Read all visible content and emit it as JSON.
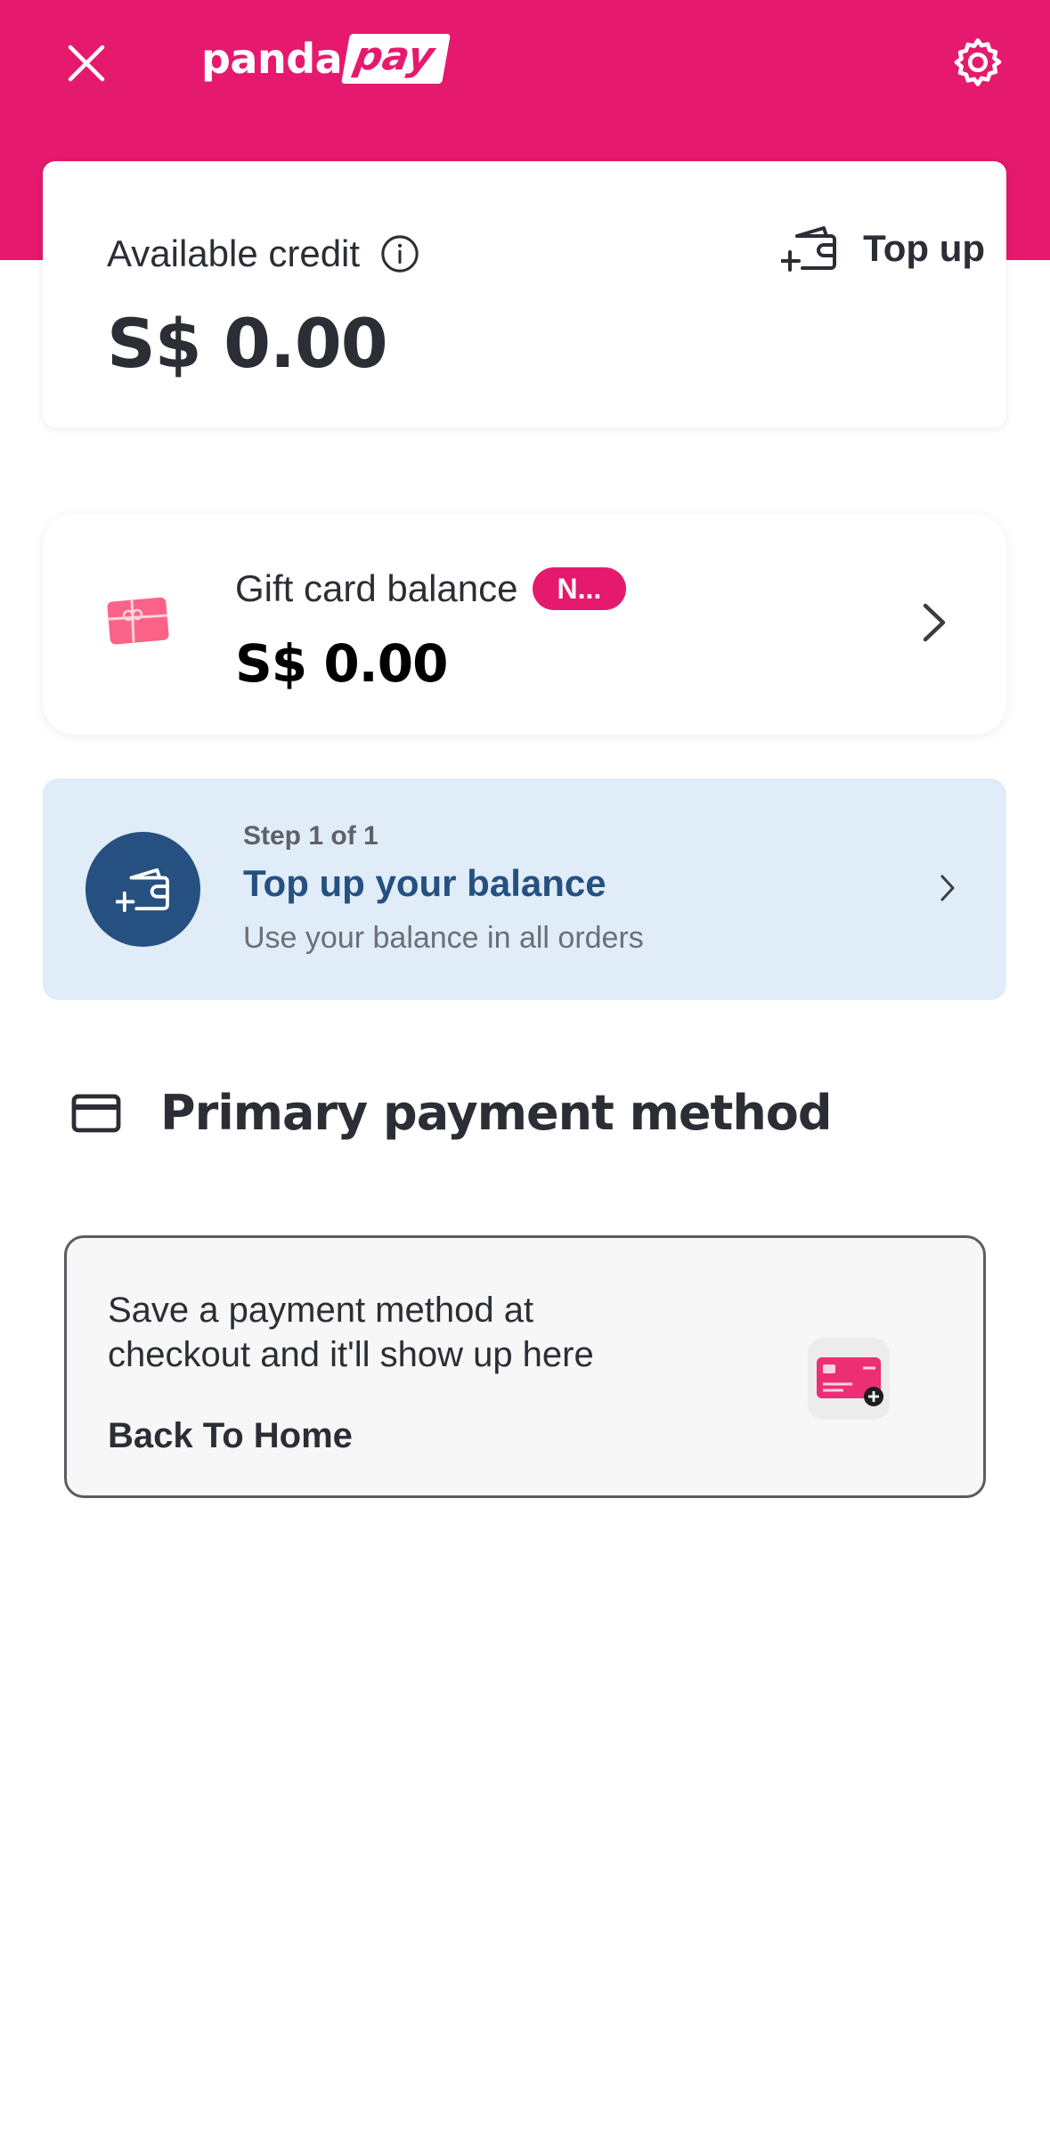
{
  "header": {
    "logo_part1": "panda",
    "logo_part2": "pay",
    "close_icon": "close-icon",
    "settings_icon": "gear-icon",
    "background_color": "#e5196d"
  },
  "credit": {
    "label": "Available credit",
    "amount": "S$ 0.00",
    "topup_label": "Top up"
  },
  "gift_card": {
    "title": "Gift card balance",
    "badge": "N...",
    "amount": "S$ 0.00"
  },
  "step": {
    "eyebrow": "Step 1 of 1",
    "title": "Top up your balance",
    "description": "Use your balance in all orders",
    "accent_color": "#255080",
    "background_color": "#e0ecf8"
  },
  "payment_method": {
    "heading": "Primary payment method",
    "empty_text": "Save a payment method at checkout and it'll show up here",
    "link_label": "Back To Home"
  }
}
